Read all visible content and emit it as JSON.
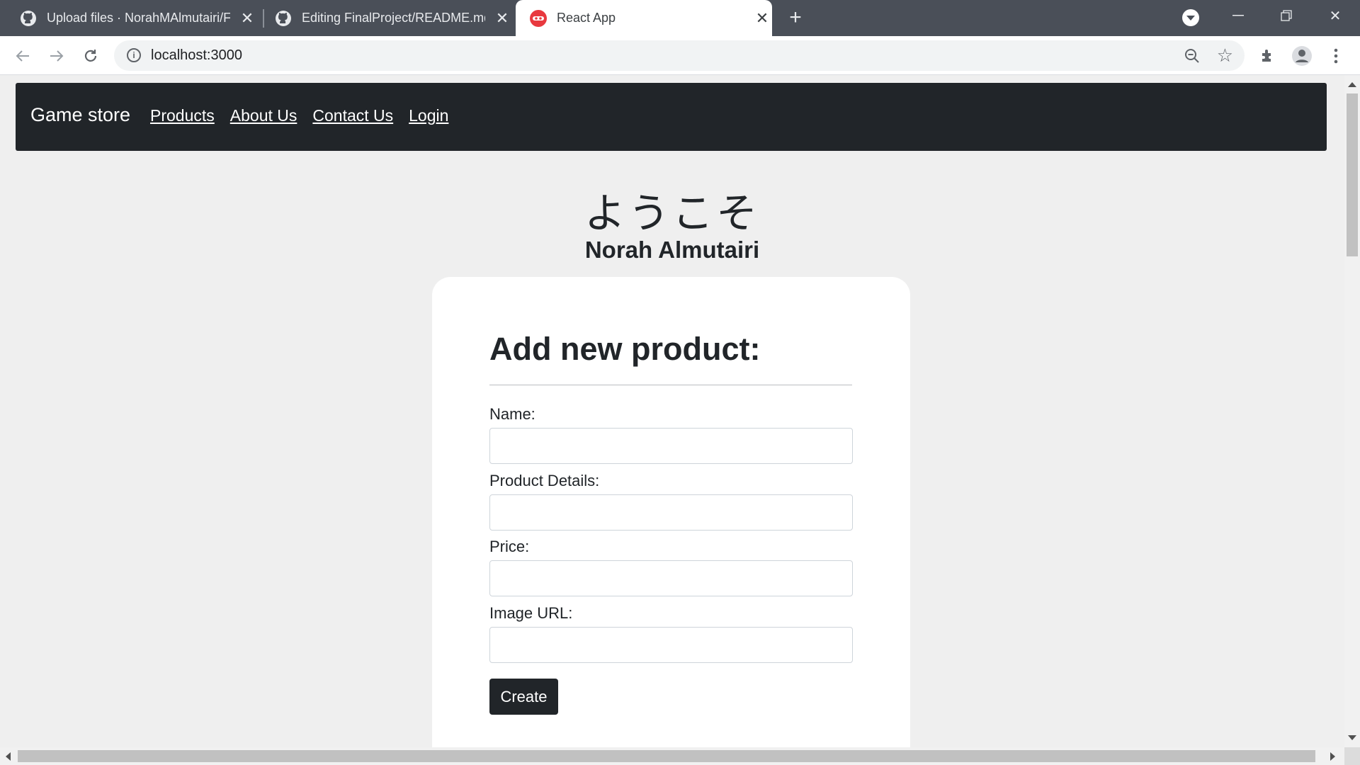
{
  "browser": {
    "tabs": [
      {
        "title": "Upload files · NorahMAlmutairi/F",
        "icon": "github-icon"
      },
      {
        "title": "Editing FinalProject/README.md",
        "icon": "github-icon"
      },
      {
        "title": "React App",
        "icon": "react-app-icon",
        "active": true
      }
    ],
    "url": "localhost:3000"
  },
  "navbar": {
    "brand": "Game store",
    "links": [
      "Products",
      "About Us",
      "Contact Us",
      "Login"
    ]
  },
  "greeting": {
    "welcome": "ようこそ",
    "name": "Norah Almutairi"
  },
  "form": {
    "title": "Add new product:",
    "fields": [
      {
        "label": "Name:",
        "value": ""
      },
      {
        "label": "Product Details:",
        "value": ""
      },
      {
        "label": "Price:",
        "value": ""
      },
      {
        "label": "Image URL:",
        "value": ""
      }
    ],
    "submit": "Create"
  },
  "colors": {
    "navbar_bg": "#212529",
    "page_bg": "#efefef",
    "tabstrip_bg": "#4a4f58"
  }
}
